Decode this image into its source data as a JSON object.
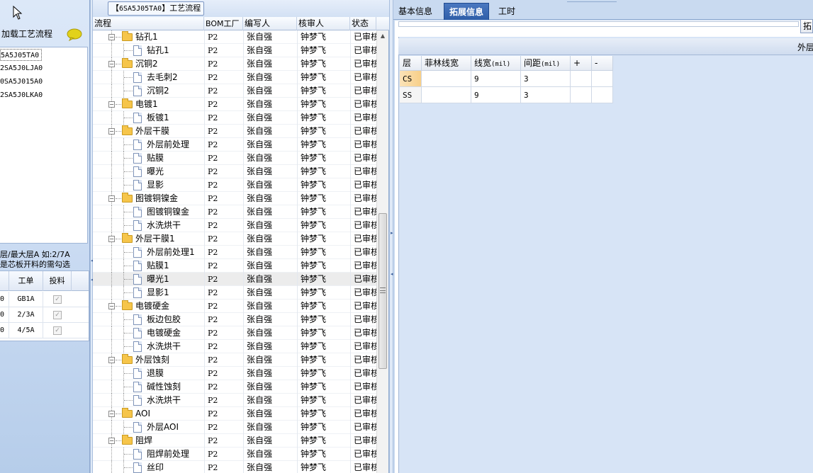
{
  "left": {
    "load_label": "加载工艺流程",
    "jobs": [
      "5A5J05TA0",
      "2SA5J0LJA0",
      "0SA5J015A0",
      "2SA5J0LKA0"
    ],
    "hint_line1": "层/最大层A 如:2/7A",
    "hint_line2": "是芯板开料的需勾选",
    "table": {
      "headers": [
        "工单",
        "投料"
      ],
      "rows": [
        {
          "lead": "0",
          "order": "GB1A",
          "checked": true
        },
        {
          "lead": "0",
          "order": "2/3A",
          "checked": true
        },
        {
          "lead": "0",
          "order": "4/5A",
          "checked": true
        }
      ]
    }
  },
  "middle": {
    "title_bracket_open": "【",
    "title_code": "6SA5J05TA0",
    "title_bracket_close": "】",
    "title_suffix": "工艺流程",
    "headers": {
      "flow": "流程",
      "bom": "BOM工厂",
      "writer": "编写人",
      "reviewer": "核审人",
      "status": "状态"
    },
    "rows": [
      {
        "level": 0,
        "name": "钻孔1",
        "bom": "P2",
        "writer": "张自强",
        "reviewer": "钟梦飞",
        "status": "已审核"
      },
      {
        "level": 1,
        "name": "钻孔1",
        "bom": "P2",
        "writer": "张自强",
        "reviewer": "钟梦飞",
        "status": "已审核"
      },
      {
        "level": 0,
        "name": "沉铜2",
        "bom": "P2",
        "writer": "张自强",
        "reviewer": "钟梦飞",
        "status": "已审核"
      },
      {
        "level": 1,
        "name": "去毛刺2",
        "bom": "P2",
        "writer": "张自强",
        "reviewer": "钟梦飞",
        "status": "已审核"
      },
      {
        "level": 1,
        "name": "沉铜2",
        "bom": "P2",
        "writer": "张自强",
        "reviewer": "钟梦飞",
        "status": "已审核"
      },
      {
        "level": 0,
        "name": "电镀1",
        "bom": "P2",
        "writer": "张自强",
        "reviewer": "钟梦飞",
        "status": "已审核"
      },
      {
        "level": 1,
        "name": "板镀1",
        "bom": "P2",
        "writer": "张自强",
        "reviewer": "钟梦飞",
        "status": "已审核"
      },
      {
        "level": 0,
        "name": "外层干膜",
        "bom": "P2",
        "writer": "张自强",
        "reviewer": "钟梦飞",
        "status": "已审核"
      },
      {
        "level": 1,
        "name": "外层前处理",
        "bom": "P2",
        "writer": "张自强",
        "reviewer": "钟梦飞",
        "status": "已审核"
      },
      {
        "level": 1,
        "name": "贴膜",
        "bom": "P2",
        "writer": "张自强",
        "reviewer": "钟梦飞",
        "status": "已审核"
      },
      {
        "level": 1,
        "name": "曝光",
        "bom": "P2",
        "writer": "张自强",
        "reviewer": "钟梦飞",
        "status": "已审核"
      },
      {
        "level": 1,
        "name": "显影",
        "bom": "P2",
        "writer": "张自强",
        "reviewer": "钟梦飞",
        "status": "已审核"
      },
      {
        "level": 0,
        "name": "图镀铜镍金",
        "bom": "P2",
        "writer": "张自强",
        "reviewer": "钟梦飞",
        "status": "已审核"
      },
      {
        "level": 1,
        "name": "图镀铜镍金",
        "bom": "P2",
        "writer": "张自强",
        "reviewer": "钟梦飞",
        "status": "已审核"
      },
      {
        "level": 1,
        "name": "水洗烘干",
        "bom": "P2",
        "writer": "张自强",
        "reviewer": "钟梦飞",
        "status": "已审核"
      },
      {
        "level": 0,
        "name": "外层干膜1",
        "bom": "P2",
        "writer": "张自强",
        "reviewer": "钟梦飞",
        "status": "已审核"
      },
      {
        "level": 1,
        "name": "外层前处理1",
        "bom": "P2",
        "writer": "张自强",
        "reviewer": "钟梦飞",
        "status": "已审核"
      },
      {
        "level": 1,
        "name": "贴膜1",
        "bom": "P2",
        "writer": "张自强",
        "reviewer": "钟梦飞",
        "status": "已审核"
      },
      {
        "level": 1,
        "name": "曝光1",
        "bom": "P2",
        "writer": "张自强",
        "reviewer": "钟梦飞",
        "status": "已审核",
        "selected": true
      },
      {
        "level": 1,
        "name": "显影1",
        "bom": "P2",
        "writer": "张自强",
        "reviewer": "钟梦飞",
        "status": "已审核"
      },
      {
        "level": 0,
        "name": "电镀硬金",
        "bom": "P2",
        "writer": "张自强",
        "reviewer": "钟梦飞",
        "status": "已审核"
      },
      {
        "level": 1,
        "name": "板边包胶",
        "bom": "P2",
        "writer": "张自强",
        "reviewer": "钟梦飞",
        "status": "已审核"
      },
      {
        "level": 1,
        "name": "电镀硬金",
        "bom": "P2",
        "writer": "张自强",
        "reviewer": "钟梦飞",
        "status": "已审核"
      },
      {
        "level": 1,
        "name": "水洗烘干",
        "bom": "P2",
        "writer": "张自强",
        "reviewer": "钟梦飞",
        "status": "已审核"
      },
      {
        "level": 0,
        "name": "外层蚀刻",
        "bom": "P2",
        "writer": "张自强",
        "reviewer": "钟梦飞",
        "status": "已审核"
      },
      {
        "level": 1,
        "name": "退膜",
        "bom": "P2",
        "writer": "张自强",
        "reviewer": "钟梦飞",
        "status": "已审核"
      },
      {
        "level": 1,
        "name": "碱性蚀刻",
        "bom": "P2",
        "writer": "张自强",
        "reviewer": "钟梦飞",
        "status": "已审核"
      },
      {
        "level": 1,
        "name": "水洗烘干",
        "bom": "P2",
        "writer": "张自强",
        "reviewer": "钟梦飞",
        "status": "已审核"
      },
      {
        "level": 0,
        "name": "AOI",
        "bom": "P2",
        "writer": "张自强",
        "reviewer": "钟梦飞",
        "status": "已审核"
      },
      {
        "level": 1,
        "name": "外层AOI",
        "bom": "P2",
        "writer": "张自强",
        "reviewer": "钟梦飞",
        "status": "已审核"
      },
      {
        "level": 0,
        "name": "阻焊",
        "bom": "P2",
        "writer": "张自强",
        "reviewer": "钟梦飞",
        "status": "已审核"
      },
      {
        "level": 1,
        "name": "阻焊前处理",
        "bom": "P2",
        "writer": "张自强",
        "reviewer": "钟梦飞",
        "status": "已审核"
      },
      {
        "level": 1,
        "name": "丝印",
        "bom": "P2",
        "writer": "张自强",
        "reviewer": "钟梦飞",
        "status": "已审核"
      }
    ]
  },
  "right": {
    "tabs": [
      {
        "label": "基本信息",
        "active": false
      },
      {
        "label": "拓展信息",
        "active": true
      },
      {
        "label": "工时",
        "active": false
      }
    ],
    "ext_button": "拓",
    "grid_caption": "外层",
    "grid": {
      "headers": [
        "层",
        "菲林线宽",
        "线宽",
        "间距",
        "+",
        "-"
      ],
      "width_unit": "(mil)",
      "space_unit": "(mil)",
      "rows": [
        {
          "layer": "CS",
          "film": "",
          "width": "9",
          "space": "3",
          "plus": "",
          "minus": "",
          "active": true
        },
        {
          "layer": "SS",
          "film": "",
          "width": "9",
          "space": "3",
          "plus": "",
          "minus": "",
          "active": false
        }
      ]
    }
  },
  "colors": {
    "accent": "#2f5ea8",
    "panel_bg": "#c9daf0",
    "folder": "#f6c54a",
    "selected_cell": "#f8cf88"
  }
}
